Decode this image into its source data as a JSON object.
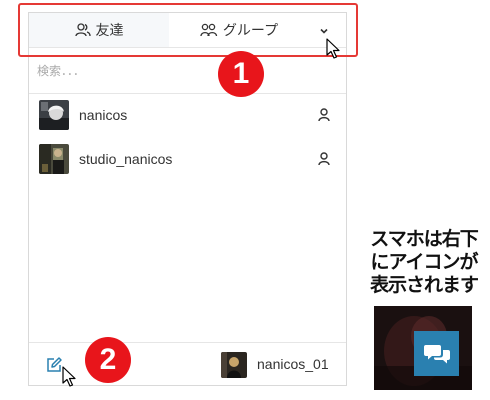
{
  "tabs": {
    "friends_label": "友達",
    "groups_label": "グループ"
  },
  "search": {
    "placeholder": "検索．．．"
  },
  "users": [
    {
      "name": "nanicos"
    },
    {
      "name": "studio_nanicos"
    }
  ],
  "footer": {
    "current_user": "nanicos_01"
  },
  "annotations": {
    "badge_1": "1",
    "badge_2": "2",
    "note_lines": [
      "スマホは右下",
      "にアイコンが",
      "表示されます"
    ]
  },
  "colors": {
    "highlight": "#e53935",
    "badge": "#e8151b",
    "chat_button": "#2a80b0"
  },
  "icons": {
    "friends_tab": "person-outline-icon",
    "groups_tab": "group-outline-icon",
    "dropdown": "chevron-down-icon",
    "user_type": "person-icon",
    "compose": "edit-pencil-icon",
    "chat": "chat-bubbles-icon"
  }
}
